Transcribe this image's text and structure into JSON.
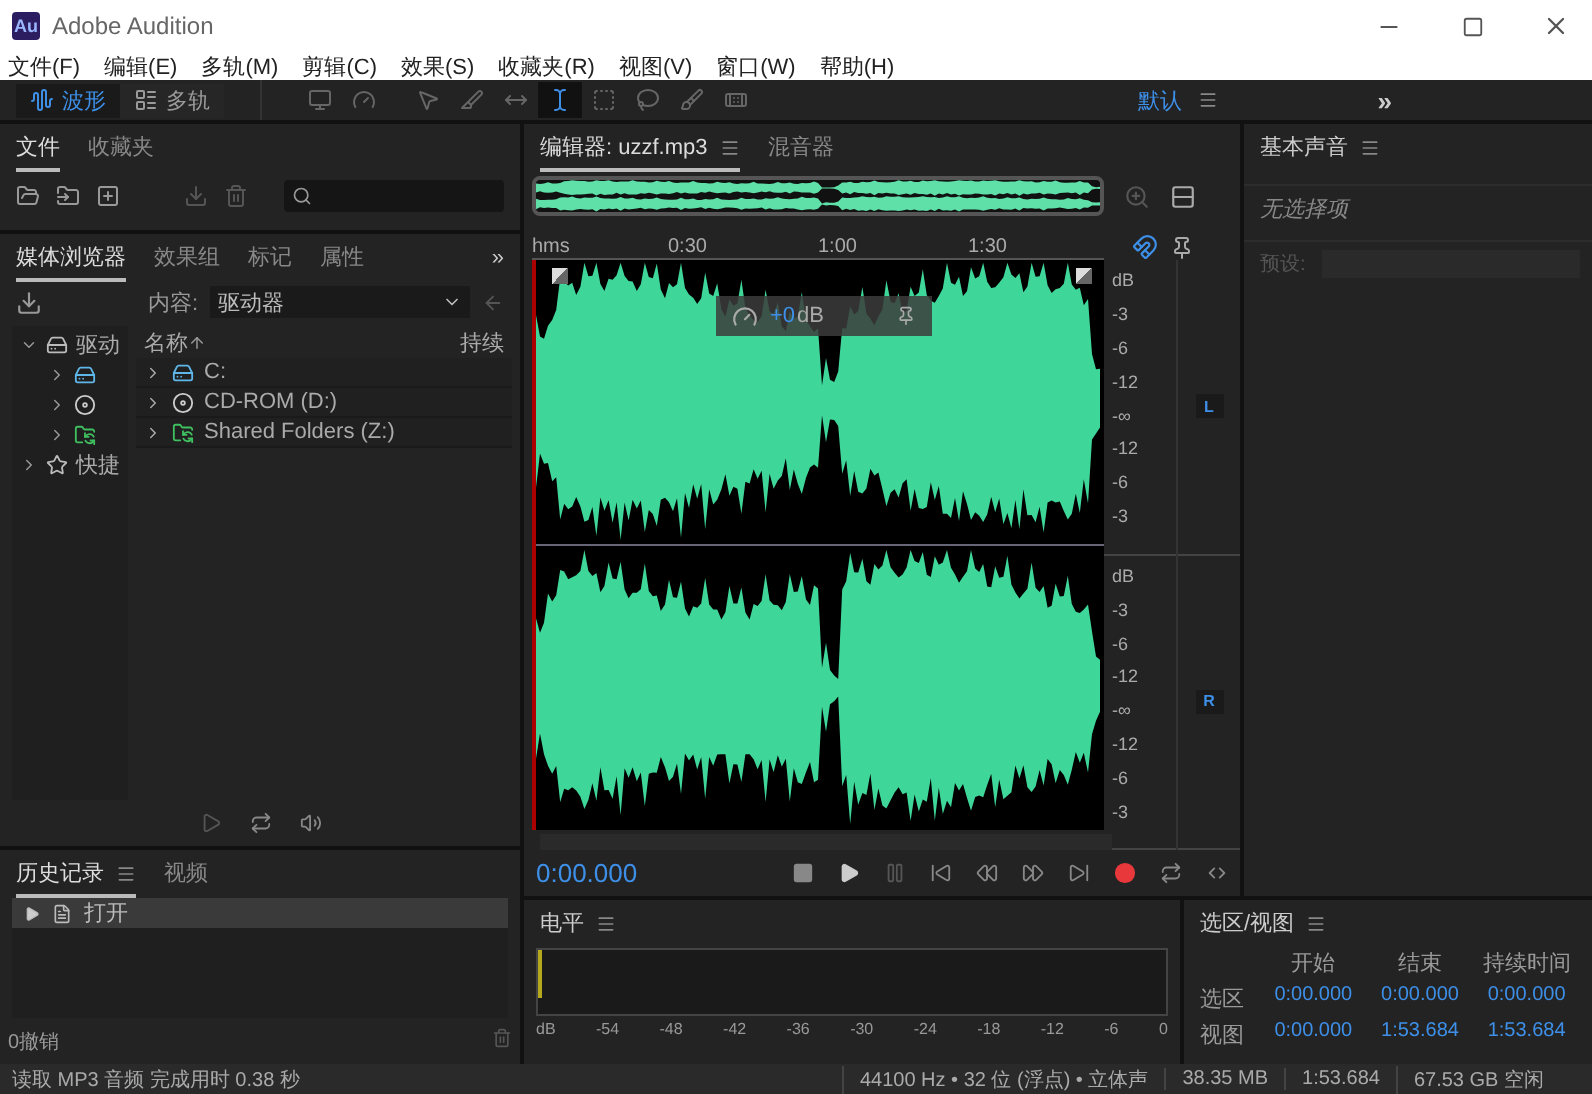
{
  "window": {
    "title": "Adobe Audition",
    "app_icon": "Au"
  },
  "menu": [
    "文件(F)",
    "编辑(E)",
    "多轨(M)",
    "剪辑(C)",
    "效果(S)",
    "收藏夹(R)",
    "视图(V)",
    "窗口(W)",
    "帮助(H)"
  ],
  "toolbar": {
    "modes": [
      {
        "label": "波形",
        "selected": true
      },
      {
        "label": "多轨",
        "selected": false
      }
    ],
    "tools": [
      {
        "kind": "move",
        "selected": false
      },
      {
        "kind": "razor",
        "selected": false
      },
      {
        "kind": "slip",
        "selected": false
      },
      {
        "kind": "time",
        "selected": true
      },
      {
        "kind": "marquee",
        "selected": false
      },
      {
        "kind": "lasso",
        "selected": false
      },
      {
        "kind": "brush",
        "selected": false
      },
      {
        "kind": "heal",
        "selected": false
      }
    ],
    "workspace": "默认",
    "more": "»"
  },
  "files_panel": {
    "tabs": [
      {
        "label": "文件",
        "selected": true
      },
      {
        "label": "收藏夹",
        "selected": false
      }
    ]
  },
  "media_browser": {
    "tabs": [
      {
        "label": "媒体浏览器",
        "selected": true
      },
      {
        "label": "效果组",
        "selected": false
      },
      {
        "label": "标记",
        "selected": false
      },
      {
        "label": "属性",
        "selected": false
      }
    ],
    "more": "»",
    "content_label": "内容:",
    "content_value": "驱动器",
    "tree": [
      {
        "label": "驱动",
        "kind": "drives",
        "expanded": true,
        "children": [
          {
            "kind": "drive",
            "expanded": false
          },
          {
            "kind": "cdrom",
            "expanded": false
          },
          {
            "kind": "shared",
            "expanded": false
          }
        ]
      },
      {
        "label": "快捷",
        "kind": "shortcut",
        "expanded": false
      }
    ],
    "columns": [
      "名称",
      "持续"
    ],
    "rows": [
      {
        "label": "C:",
        "kind": "drive"
      },
      {
        "label": "CD-ROM (D:)",
        "kind": "cdrom"
      },
      {
        "label": "Shared Folders (Z:)",
        "kind": "shared"
      }
    ]
  },
  "history": {
    "tabs": [
      {
        "label": "历史记录",
        "selected": true
      },
      {
        "label": "视频",
        "selected": false
      }
    ],
    "items": [
      {
        "label": "打开",
        "selected": true
      }
    ],
    "undo": "0撤销"
  },
  "editor": {
    "tabs": [
      {
        "label": "编辑器: uzzf.mp3",
        "selected": true
      },
      {
        "label": "混音器",
        "selected": false
      }
    ],
    "ruler": [
      "hms",
      "0:30",
      "1:00",
      "1:30"
    ],
    "hud": {
      "gain": "+0",
      "unit": "dB"
    },
    "channels": [
      {
        "label": "L",
        "scale": [
          "dB",
          "-3",
          "-6",
          "-12",
          "-∞",
          "-12",
          "-6",
          "-3"
        ]
      },
      {
        "label": "R",
        "scale": [
          "dB",
          "-3",
          "-6",
          "-12",
          "-∞",
          "-12",
          "-6",
          "-3"
        ]
      }
    ],
    "time": "0:00.000",
    "transport": [
      {
        "kind": "stop"
      },
      {
        "kind": "play"
      },
      {
        "kind": "pause"
      },
      {
        "kind": "start"
      },
      {
        "kind": "rewind"
      },
      {
        "kind": "forward"
      },
      {
        "kind": "end"
      },
      {
        "kind": "record"
      },
      {
        "kind": "loop"
      },
      {
        "kind": "skip"
      }
    ]
  },
  "basic_sound": {
    "title": "基本声音",
    "hint": "无选择项",
    "preset_label": "预设:"
  },
  "levels": {
    "title": "电平",
    "scale": [
      "dB",
      "-54",
      "-48",
      "-42",
      "-36",
      "-30",
      "-24",
      "-18",
      "-12",
      "-6",
      "0"
    ]
  },
  "selection_view": {
    "title": "选区/视图",
    "columns": [
      "开始",
      "结束",
      "持续时间"
    ],
    "rows": [
      {
        "label": "选区",
        "values": [
          "0:00.000",
          "0:00.000",
          "0:00.000"
        ]
      },
      {
        "label": "视图",
        "values": [
          "0:00.000",
          "1:53.684",
          "1:53.684"
        ]
      }
    ]
  },
  "status": {
    "message": "读取 MP3 音频 完成用时 0.38 秒",
    "items": [
      "44100 Hz • 32 位 (浮点) • 立体声",
      "38.35 MB",
      "1:53.684",
      "67.53 GB 空闲"
    ]
  }
}
